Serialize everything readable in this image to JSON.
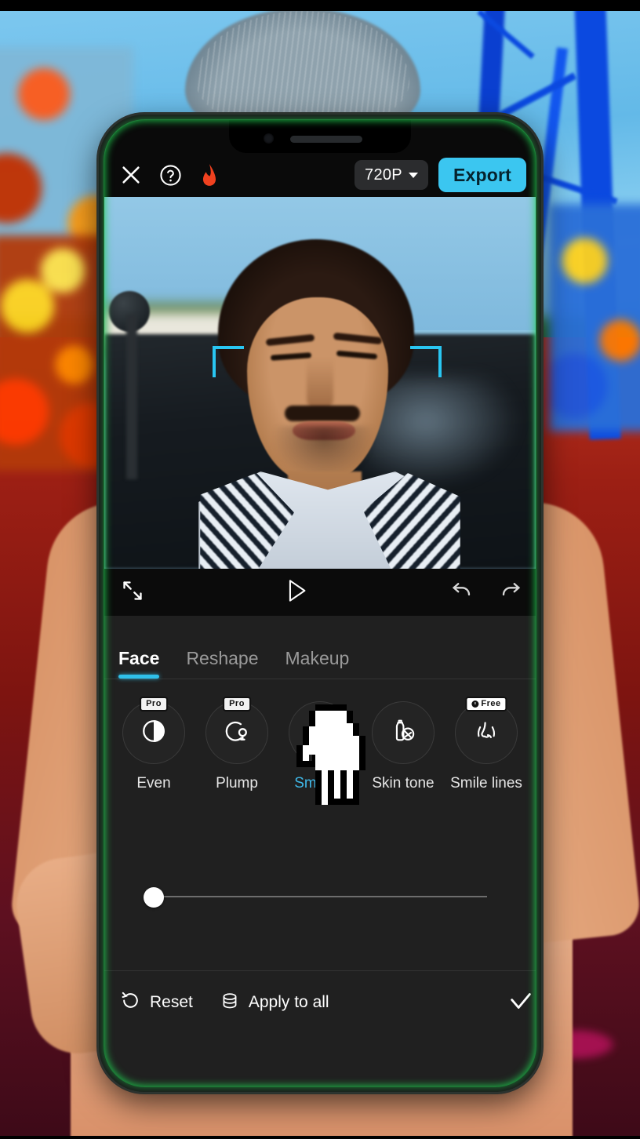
{
  "app": {
    "topbar": {
      "close_icon": "close-x-icon",
      "help_icon": "help-question-icon",
      "flame_icon": "flame-icon",
      "resolution_label": "720P",
      "resolution_caret": "chevron-down-icon",
      "export_label": "Export",
      "export_color": "#3bc6f0"
    },
    "preview": {
      "face_bracket_color": "#29c6f2"
    },
    "controlbar": {
      "fullscreen_icon": "fullscreen-expand-icon",
      "play_icon": "play-icon",
      "undo_icon": "undo-icon",
      "redo_icon": "redo-icon"
    },
    "tabs": [
      {
        "label": "Face",
        "active": true
      },
      {
        "label": "Reshape",
        "active": false
      },
      {
        "label": "Makeup",
        "active": false
      }
    ],
    "tools": [
      {
        "label": "Even",
        "icon": "contrast-circle-icon",
        "badge": "Pro",
        "badge_type": "pro",
        "selected": false
      },
      {
        "label": "Plump",
        "icon": "plump-balloon-icon",
        "badge": "Pro",
        "badge_type": "pro",
        "selected": false
      },
      {
        "label": "Smooth",
        "icon": "water-droplet-icon",
        "badge": "",
        "badge_type": "",
        "selected": true
      },
      {
        "label": "Skin tone",
        "icon": "bottle-sphere-icon",
        "badge": "",
        "badge_type": "",
        "selected": false
      },
      {
        "label": "Smile lines",
        "icon": "nose-smile-lines-icon",
        "badge": "Free",
        "badge_type": "free",
        "selected": false
      }
    ],
    "slider": {
      "value": 0,
      "min": 0,
      "max": 100
    },
    "bottombar": {
      "reset_icon": "reset-rotate-icon",
      "reset_label": "Reset",
      "apply_icon": "stack-layers-icon",
      "apply_label": "Apply to all",
      "confirm_icon": "check-icon"
    },
    "accent_color": "#3fb8e8",
    "selected_tool_color": "#3fb8e8",
    "cursor_icon": "pointing-hand-cursor"
  }
}
